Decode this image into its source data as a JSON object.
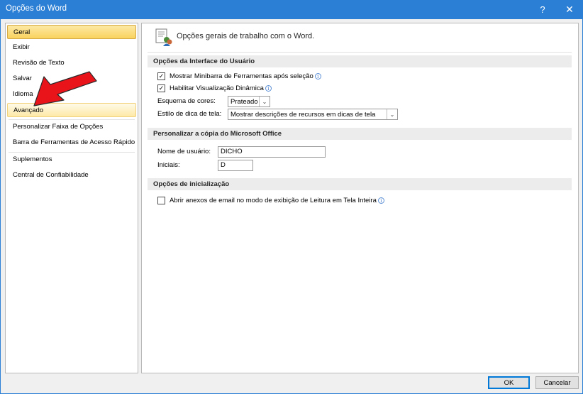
{
  "window": {
    "title": "Opções do Word",
    "help_label": "?",
    "close_label": "✕"
  },
  "sidebar": {
    "items": [
      {
        "label": "Geral",
        "state": "selected"
      },
      {
        "label": "Exibir"
      },
      {
        "label": "Revisão de Texto"
      },
      {
        "label": "Salvar"
      },
      {
        "label": "Idioma"
      },
      {
        "label": "Avançado",
        "state": "hover"
      },
      {
        "label": "Personalizar Faixa de Opções"
      },
      {
        "label": "Barra de Ferramentas de Acesso Rápido"
      },
      {
        "label": "Suplementos"
      },
      {
        "label": "Central de Confiabilidade"
      }
    ]
  },
  "panel": {
    "header": "Opções gerais de trabalho com o Word.",
    "ui_section": {
      "title": "Opções da Interface do Usuário",
      "minibar": {
        "label": "Mostrar Minibarra de Ferramentas após seleção",
        "checked": true
      },
      "live_preview": {
        "label": "Habilitar Visualização Dinâmica",
        "checked": true
      },
      "color_scheme": {
        "label": "Esquema de cores:",
        "value": "Prateado"
      },
      "tooltip_style": {
        "label": "Estilo de dica de tela:",
        "value": "Mostrar descrições de recursos em dicas de tela"
      }
    },
    "personalize_section": {
      "title": "Personalizar a cópia do Microsoft Office",
      "username": {
        "label": "Nome de usuário:",
        "value": "DICHO"
      },
      "initials": {
        "label": "Iniciais:",
        "value": "D"
      }
    },
    "startup_section": {
      "title": "Opções de inicialização",
      "open_attachments": {
        "label": "Abrir anexos de email no modo de exibição de Leitura em Tela Inteira",
        "checked": false
      }
    }
  },
  "footer": {
    "ok_label": "OK",
    "cancel_label": "Cancelar"
  },
  "colors": {
    "titlebar": "#2b7fd5",
    "selected_item": "#f9d35e",
    "annotation_arrow": "#e8141a"
  },
  "icons": {
    "header": "general-options-icon",
    "info": "info-icon",
    "dropdown": "chevron-down-icon",
    "annotation": "red-arrow-icon"
  }
}
